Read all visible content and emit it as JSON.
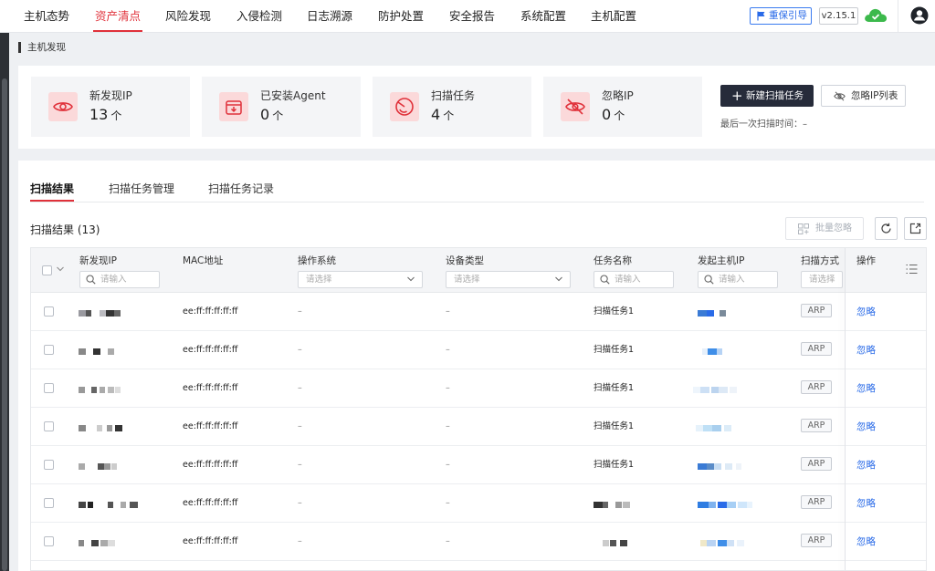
{
  "nav": {
    "items": [
      "主机态势",
      "资产清点",
      "风险发现",
      "入侵检测",
      "日志溯源",
      "防护处置",
      "安全报告",
      "系统配置",
      "主机配置"
    ],
    "active": "资产清点",
    "guide_label": "重保引导",
    "version": "v2.15.1"
  },
  "breadcrumb": "主机发现",
  "stats": [
    {
      "label": "新发现IP",
      "value": "13",
      "unit": "个",
      "icon": "eye-icon"
    },
    {
      "label": "已安装Agent",
      "value": "0",
      "unit": "个",
      "icon": "agent-box-icon"
    },
    {
      "label": "扫描任务",
      "value": "4",
      "unit": "个",
      "icon": "scan-target-icon"
    },
    {
      "label": "忽略IP",
      "value": "0",
      "unit": "个",
      "icon": "eye-off-icon"
    }
  ],
  "actions": {
    "new_scan_label": "新建扫描任务",
    "ignore_list_label": "忽略IP列表",
    "last_scan_text": "最后一次扫描时间：–"
  },
  "tabs": [
    "扫描结果",
    "扫描任务管理",
    "扫描任务记录"
  ],
  "results": {
    "title": "扫描结果 (13)",
    "batch_ignore_label": "批量忽略"
  },
  "table": {
    "headers": {
      "ip": "新发现IP",
      "mac": "MAC地址",
      "os": "操作系统",
      "device": "设备类型",
      "task": "任务名称",
      "host_ip": "发起主机IP",
      "method": "扫描方式",
      "action": "操作"
    },
    "filters": {
      "input_placeholder": "请输入",
      "select_placeholder": "请选择",
      "method_placeholder": "请选择"
    },
    "rows": [
      {
        "mac": "ee:ff:ff:ff:ff:ff",
        "os": "–",
        "device": "–",
        "task": "扫描任务1",
        "method": "ARP",
        "action": "忽略"
      },
      {
        "mac": "ee:ff:ff:ff:ff:ff",
        "os": "–",
        "device": "–",
        "task": "扫描任务1",
        "method": "ARP",
        "action": "忽略"
      },
      {
        "mac": "ee:ff:ff:ff:ff:ff",
        "os": "–",
        "device": "–",
        "task": "扫描任务1",
        "method": "ARP",
        "action": "忽略"
      },
      {
        "mac": "ee:ff:ff:ff:ff:ff",
        "os": "–",
        "device": "–",
        "task": "扫描任务1",
        "method": "ARP",
        "action": "忽略"
      },
      {
        "mac": "ee:ff:ff:ff:ff:ff",
        "os": "–",
        "device": "–",
        "task": "扫描任务1",
        "method": "ARP",
        "action": "忽略"
      },
      {
        "mac": "ee:ff:ff:ff:ff:ff",
        "os": "–",
        "device": "–",
        "task": "",
        "method": "ARP",
        "action": "忽略"
      },
      {
        "mac": "ee:ff:ff:ff:ff:ff",
        "os": "–",
        "device": "–",
        "task": "",
        "method": "ARP",
        "action": "忽略"
      }
    ]
  },
  "colors": {
    "accent": "#e0313a",
    "link": "#2a6be8",
    "primary_button": "#262b3a"
  }
}
